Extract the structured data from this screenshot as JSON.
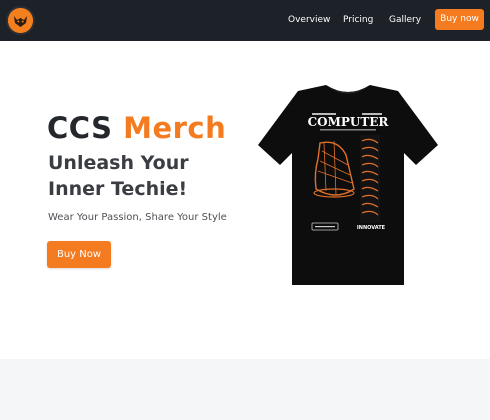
{
  "nav": {
    "logo_icon": "fox-logo-icon",
    "links": [
      "Overview",
      "Pricing",
      "Gallery"
    ],
    "cta": "Buy now"
  },
  "hero": {
    "title_main": "CCS ",
    "title_accent": "Merch",
    "subtitle": "Unleash Your Inner Techie!",
    "tagline": "Wear Your Passion, Share Your Style",
    "cta": "Buy Now",
    "shirt_text": "COMPUTER",
    "shirt_badge": "INNOVATE"
  },
  "colors": {
    "accent": "#f47b20",
    "navbar": "#1d2128",
    "text_dark": "#24272b"
  }
}
